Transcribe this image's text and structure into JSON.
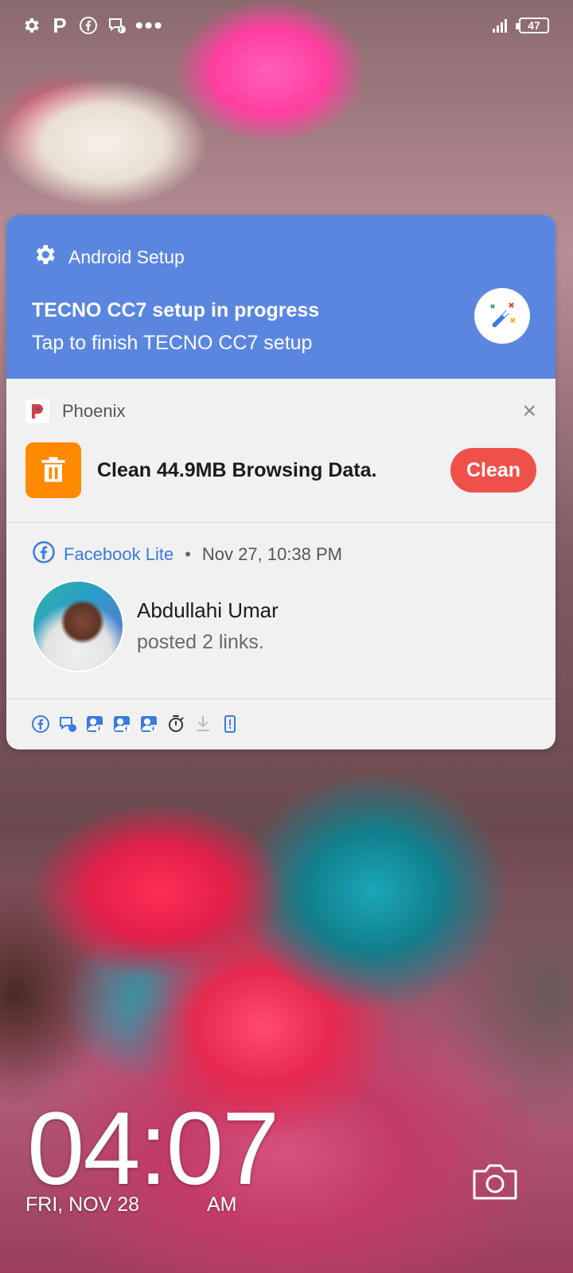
{
  "status_bar": {
    "left_icons": [
      "gear-icon",
      "p-letter-icon",
      "facebook-icon",
      "messenger-icon",
      "more-dots-icon"
    ],
    "p_letter": "P",
    "more": "•••",
    "battery": "47"
  },
  "notifications": {
    "setup": {
      "app_name": "Android Setup",
      "title": "TECNO CC7 setup in progress",
      "text": "Tap to finish TECNO CC7 setup",
      "color": "#5a86e0"
    },
    "phoenix": {
      "app_name": "Phoenix",
      "text": "Clean 44.9MB Browsing Data.",
      "button_label": "Clean",
      "close": "×",
      "accent": "#f0504a"
    },
    "facebook": {
      "app_name": "Facebook Lite",
      "separator": "•",
      "time": "Nov 27, 10:38 PM",
      "name": "Abdullahi Umar",
      "text": "posted 2 links."
    },
    "icon_row": [
      "facebook-icon",
      "messenger-icon",
      "fb-people-icon",
      "fb-people-icon",
      "fb-people-icon",
      "stopwatch-icon",
      "download-icon",
      "phone-alert-icon"
    ]
  },
  "lockscreen": {
    "time": "04:07",
    "date": "FRI, NOV 28",
    "ampm": "AM"
  }
}
